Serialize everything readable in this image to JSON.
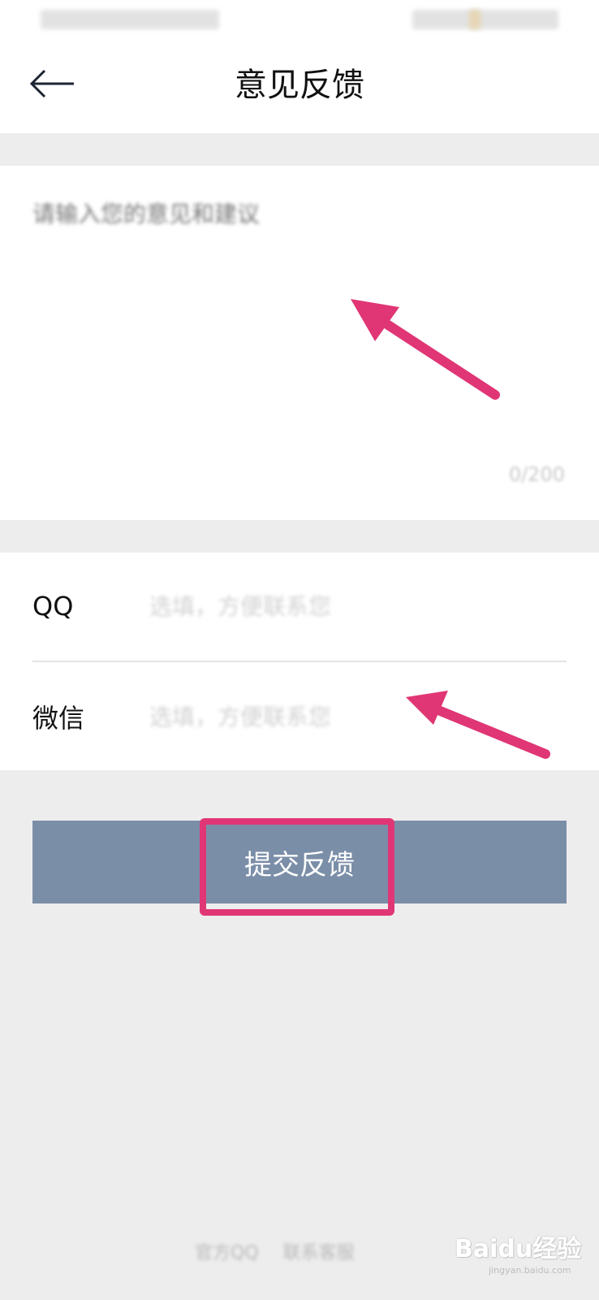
{
  "header": {
    "title": "意见反馈",
    "back_icon": "arrow-left-icon"
  },
  "feedback": {
    "placeholder": "请输入您的意见和建议",
    "char_count": "0/200"
  },
  "contact": {
    "qq_label": "QQ",
    "qq_placeholder": "选填，方便联系您",
    "wechat_label": "微信",
    "wechat_placeholder": "选填，方便联系您"
  },
  "submit": {
    "label": "提交反馈"
  },
  "footer": {
    "link1": "官方QQ",
    "link2": "联系客服"
  },
  "watermark": {
    "text": "Baidu经验",
    "sub": "jingyan.baidu.com"
  },
  "colors": {
    "accent_annotation": "#e03675",
    "submit_bg": "#7b8ea8",
    "page_bg": "#ededed"
  }
}
